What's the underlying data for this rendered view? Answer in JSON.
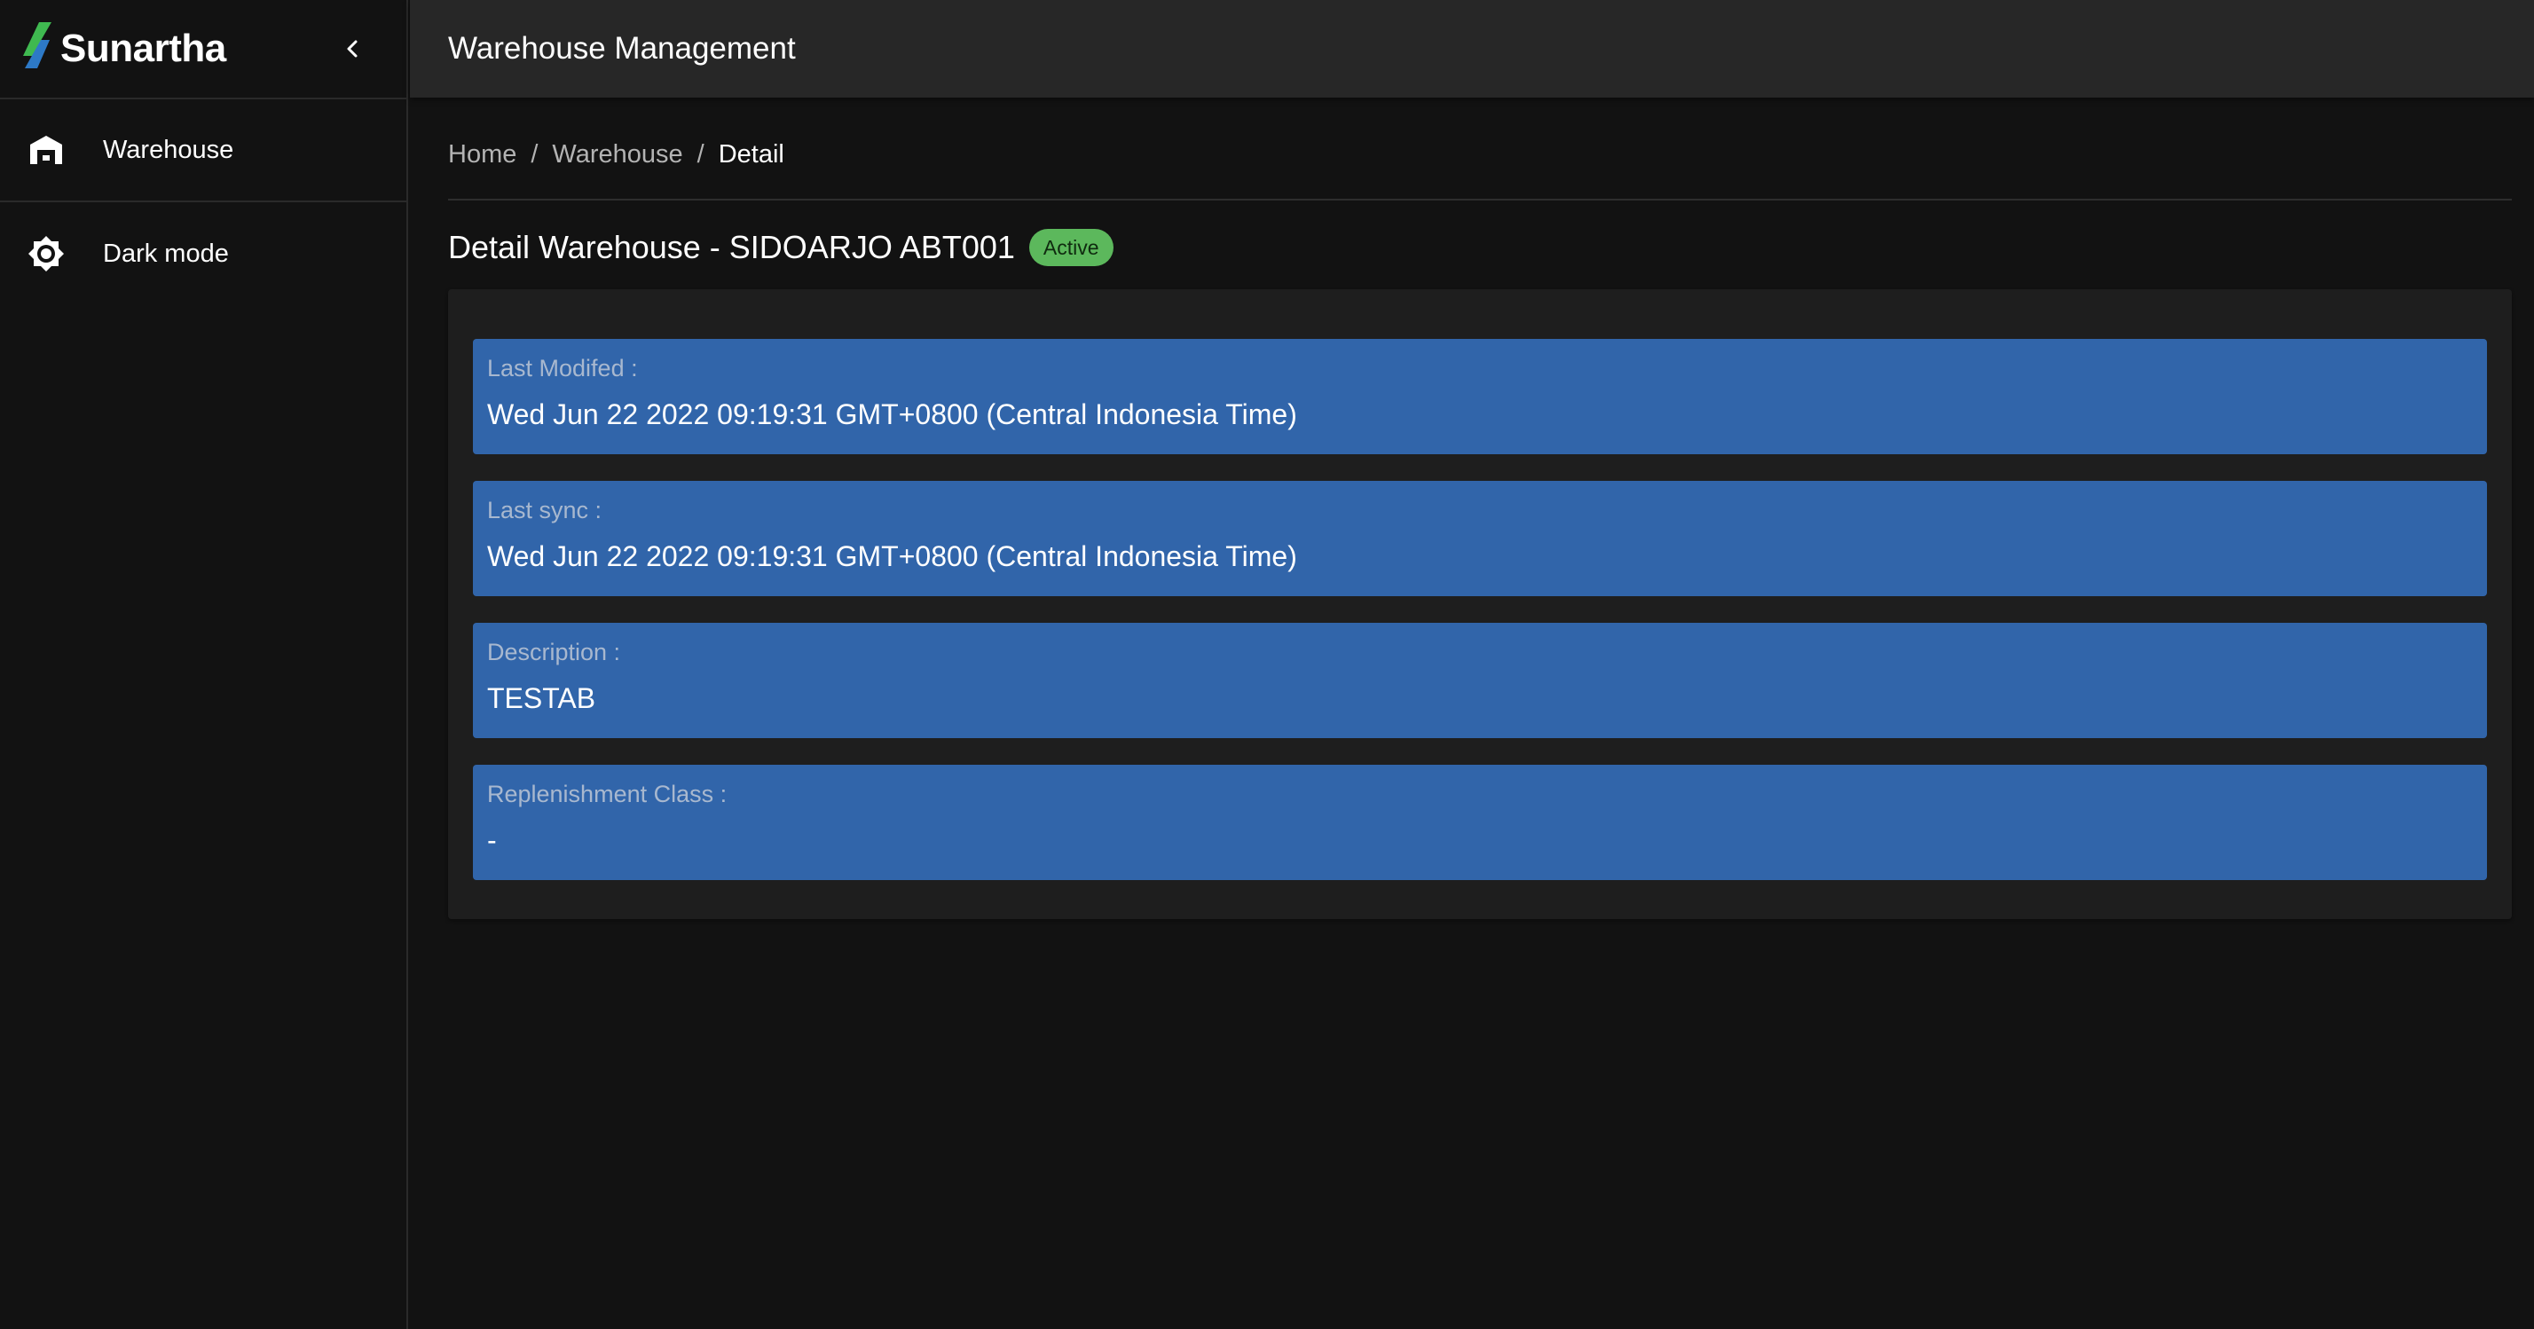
{
  "brand": {
    "name": "Sunartha",
    "colors": {
      "mark_green": "#3fb950",
      "mark_blue": "#2f7fd1"
    }
  },
  "sidebar": {
    "collapse_icon": "chevron-left-icon",
    "items": [
      {
        "label": "Warehouse",
        "icon": "warehouse-icon"
      },
      {
        "label": "Dark mode",
        "icon": "brightness-icon"
      }
    ]
  },
  "topbar": {
    "title": "Warehouse Management"
  },
  "breadcrumb": {
    "items": [
      "Home",
      "Warehouse",
      "Detail"
    ],
    "separator": "/"
  },
  "page": {
    "title": "Detail Warehouse - SIDOARJO ABT001",
    "status": "Active",
    "status_color": "#5cb85c"
  },
  "details": [
    {
      "label": "Last Modifed :",
      "value": "Wed Jun 22 2022 09:19:31 GMT+0800 (Central Indonesia Time)"
    },
    {
      "label": "Last sync :",
      "value": "Wed Jun 22 2022 09:19:31 GMT+0800 (Central Indonesia Time)"
    },
    {
      "label": "Description :",
      "value": "TESTAB"
    },
    {
      "label": "Replenishment Class :",
      "value": "-"
    }
  ],
  "theme": {
    "background": "#121212",
    "topbar": "#272727",
    "card": "#1e1e1e",
    "field": "#3165aa"
  }
}
